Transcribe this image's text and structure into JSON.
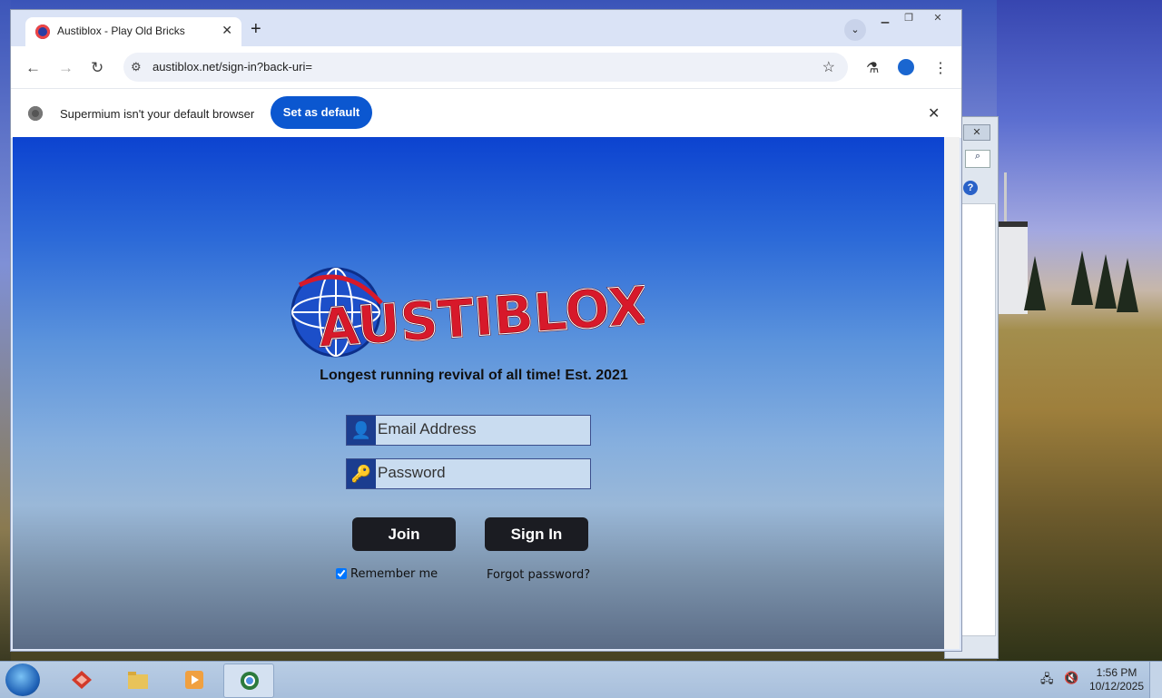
{
  "browser": {
    "tab_title": "Austiblox - Play Old Bricks",
    "url": "austiblox.net/sign-in?back-uri=",
    "new_tab_symbol": "+",
    "close_tab_symbol": "✕"
  },
  "infobar": {
    "message": "Supermium isn't your default browser",
    "button_label": "Set as default"
  },
  "page": {
    "logo_text": "AUSTIBLOX",
    "tagline": "Longest running revival of all time! Est. 2021",
    "email_placeholder": "Email Address",
    "password_placeholder": "Password",
    "join_label": "Join",
    "signin_label": "Sign In",
    "remember_label": "Remember me",
    "remember_checked": true,
    "forgot_label": "Forgot password?"
  },
  "taskbar": {
    "time": "1:56 PM",
    "date": "10/12/2025"
  },
  "colors": {
    "accent": "#0b57d0",
    "logo_red": "#d7192a",
    "field_icon_bg": "#1b3d8f",
    "button_dark": "#1b1c22"
  }
}
